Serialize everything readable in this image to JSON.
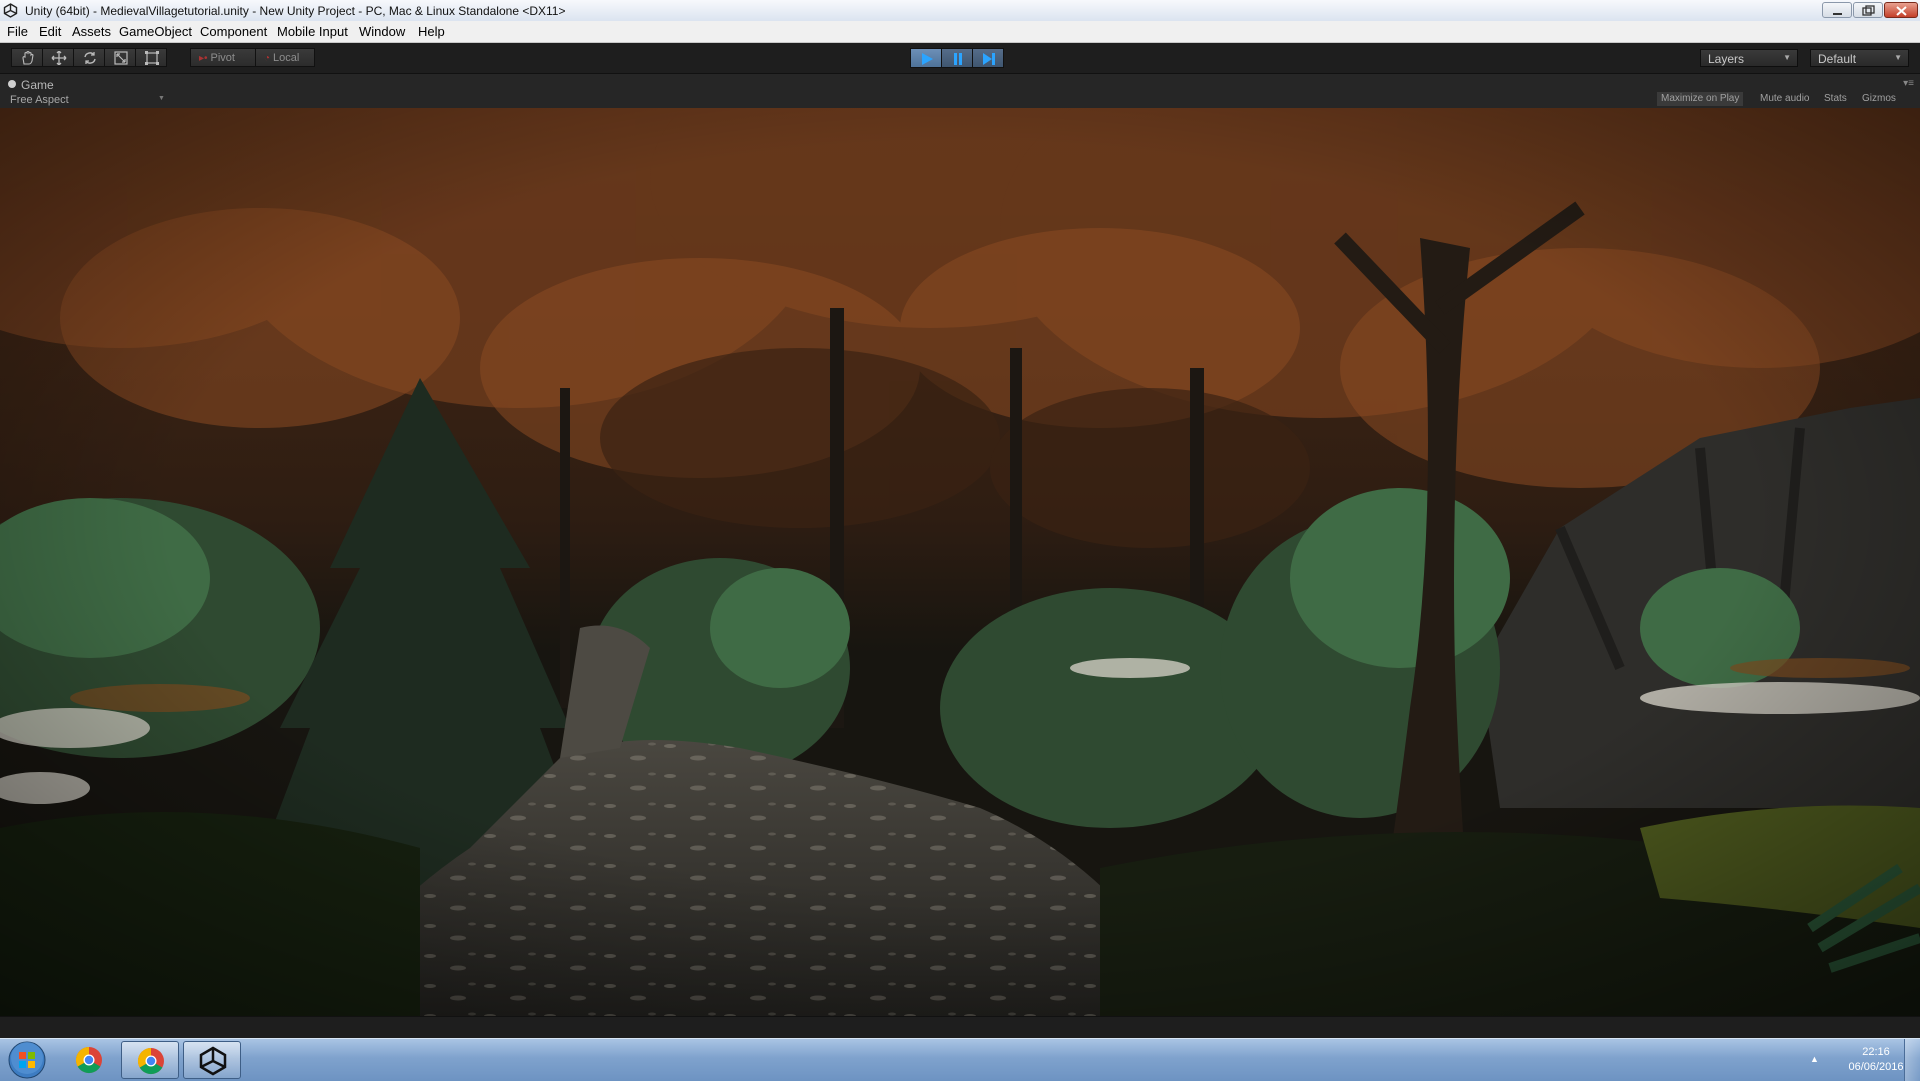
{
  "window": {
    "title": "Unity (64bit) - MedievalVillagetutorial.unity - New Unity Project - PC, Mac & Linux Standalone <DX11>",
    "app_icon": "unity-icon"
  },
  "menu": [
    "File",
    "Edit",
    "Assets",
    "GameObject",
    "Component",
    "Mobile Input",
    "Window",
    "Help"
  ],
  "toolbar": {
    "tools": [
      "hand-icon",
      "move-icon",
      "rotate-icon",
      "scale-icon",
      "rect-icon"
    ],
    "pivot_label": "Pivot",
    "local_label": "Local",
    "play_controls": [
      "play-icon",
      "pause-icon",
      "step-icon"
    ],
    "layers_label": "Layers",
    "layout_label": "Default"
  },
  "game_view": {
    "tab_label": "Game",
    "aspect_label": "Free Aspect",
    "maximize_on_play": "Maximize on Play",
    "mute_audio": "Mute audio",
    "stats": "Stats",
    "gizmos": "Gizmos"
  },
  "taskbar": {
    "apps": [
      "chrome-icon",
      "chrome-icon",
      "unity-icon"
    ],
    "time": "22:16",
    "date": "06/06/2016"
  },
  "colors": {
    "toolbar_bg": "#1e1e1e",
    "play_active": "#5a7fa8",
    "taskbar": "#7fa2cd",
    "foliage_autumn": "#6b3a1c",
    "foliage_green": "#3f6b45"
  }
}
